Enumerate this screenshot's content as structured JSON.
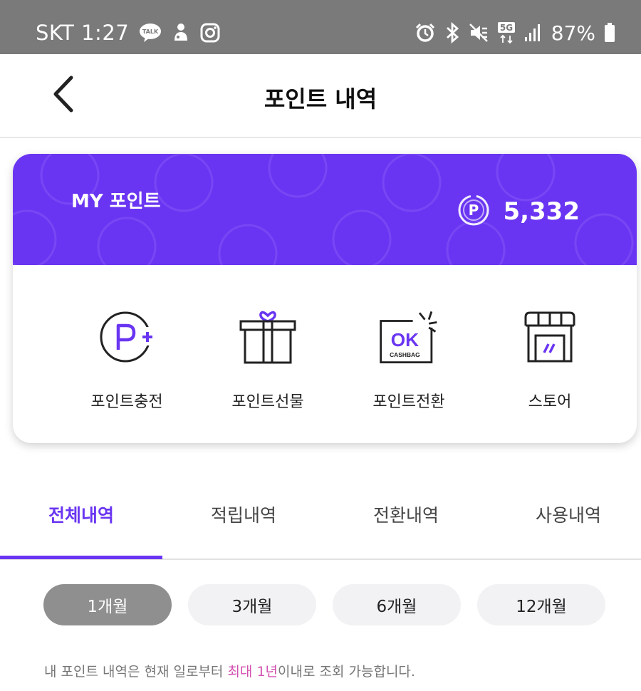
{
  "status_bar": {
    "carrier": "SKT",
    "time": "1:27",
    "talk_badge": "TALK",
    "network": "5G",
    "battery": "87%",
    "left_icons": [
      "kakao-talk-icon",
      "notification-icon",
      "instagram-icon"
    ],
    "right_icons": [
      "alarm-icon",
      "bluetooth-icon",
      "mute-icon",
      "network-5g-icon",
      "signal-icon",
      "battery-icon"
    ]
  },
  "header": {
    "title": "포인트 내역",
    "back_icon": "chevron-left-icon"
  },
  "point_card": {
    "label": "MY 포인트",
    "balance": "5,332",
    "point_badge": "P",
    "accent_color": "#6a35f2"
  },
  "actions": [
    {
      "label": "포인트충전",
      "icon": "point-charge-icon"
    },
    {
      "label": "포인트선물",
      "icon": "gift-box-icon"
    },
    {
      "label": "포인트전환",
      "icon": "ok-cashbag-icon"
    },
    {
      "label": "스토어",
      "icon": "store-icon"
    }
  ],
  "ok_icon_text": {
    "ok": "OK",
    "cashbag": "CASHBAG"
  },
  "tabs": [
    {
      "label": "전체내역",
      "active": true
    },
    {
      "label": "적립내역",
      "active": false
    },
    {
      "label": "전환내역",
      "active": false
    },
    {
      "label": "사용내역",
      "active": false
    }
  ],
  "periods": [
    {
      "label": "1개월",
      "selected": true
    },
    {
      "label": "3개월",
      "selected": false
    },
    {
      "label": "6개월",
      "selected": false
    },
    {
      "label": "12개월",
      "selected": false
    }
  ],
  "notice": {
    "before": "내 포인트 내역은 현재 일로부터 ",
    "highlight": "최대 1년",
    "after": "이내로 조회 가능합니다.",
    "highlight_color": "#d24fb0"
  }
}
